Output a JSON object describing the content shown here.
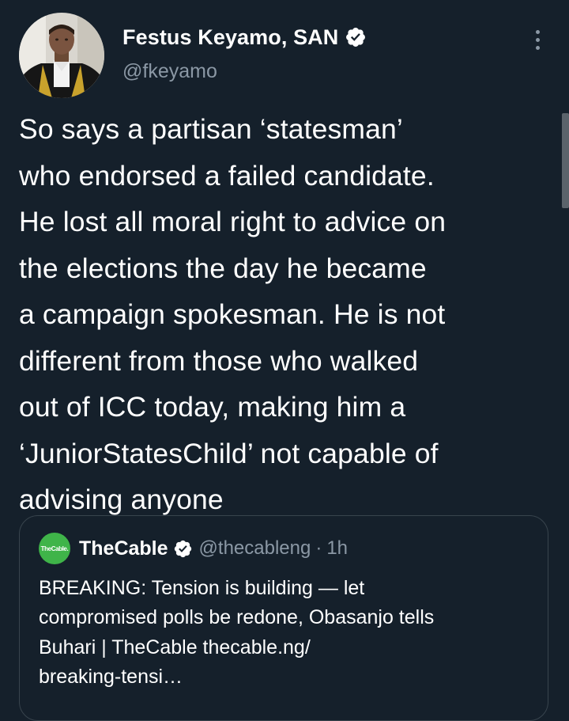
{
  "author": {
    "name": "Festus Keyamo, SAN",
    "handle": "@fkeyamo",
    "verified_icon": "verified-badge-icon",
    "avatar_icon": "profile-photo"
  },
  "menu": {
    "icon": "more-vertical-icon"
  },
  "tweet": {
    "lines": [
      "So says a partisan ‘statesman’",
      "who endorsed a failed candidate.",
      "He lost all moral right to advice on",
      "the elections the day he became",
      "a campaign spokesman. He is not",
      "different from those who walked",
      "out of ICC today, making him a",
      "‘JuniorStatesChild’ not capable of",
      "advising anyone"
    ]
  },
  "quote": {
    "avatar_label": "TheCable.",
    "name": "TheCable",
    "handle": "@thecableng",
    "separator": "·",
    "time": "1h",
    "lines": [
      "BREAKING: Tension is building — let",
      "compromised polls be redone, Obasanjo tells",
      "Buhari | TheCable thecable.ng/",
      "breaking-tensi…"
    ]
  },
  "colors": {
    "background": "#15202b",
    "text": "#ffffff",
    "secondary": "#8b98a5",
    "border": "#38444d",
    "verified": "#ffffff",
    "quote_avatar": "#3fb449"
  }
}
